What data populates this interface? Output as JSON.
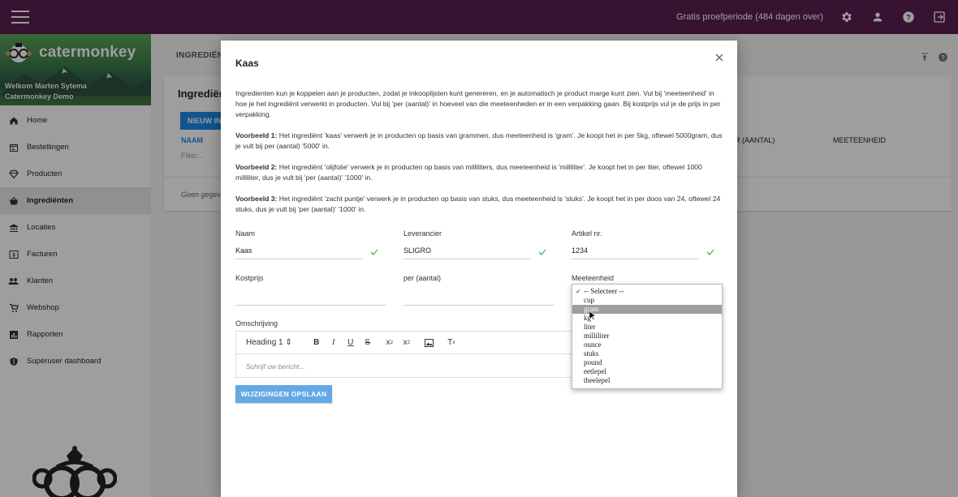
{
  "topbar": {
    "trial_text": "Gratis proefperiode (484 dagen over)",
    "icons": [
      "menu-icon",
      "gear-icon",
      "account-icon",
      "help-icon",
      "logout-icon"
    ],
    "color": "#5a1f50"
  },
  "sidebar": {
    "logo_text": "catermonkey",
    "welcome_line1": "Welkom Marten Sytema",
    "welcome_line2": "Catermonkey Demo",
    "items": [
      {
        "label": "Home",
        "icon": "home-icon"
      },
      {
        "label": "Bestellingen",
        "icon": "calendar-icon"
      },
      {
        "label": "Producten",
        "icon": "diamond-icon"
      },
      {
        "label": "Ingrediënten",
        "icon": "basket-icon",
        "active": true
      },
      {
        "label": "Locaties",
        "icon": "bank-icon"
      },
      {
        "label": "Facturen",
        "icon": "dollar-icon"
      },
      {
        "label": "Klanten",
        "icon": "people-icon"
      },
      {
        "label": "Webshop",
        "icon": "cart-icon"
      },
      {
        "label": "Rapporten",
        "icon": "chart-icon"
      },
      {
        "label": "Superuser dashboard",
        "icon": "shield-icon"
      }
    ]
  },
  "main": {
    "breadcrumb": "INGREDIËNT",
    "card_title": "Ingrediënt",
    "new_button": "NIEUW IN",
    "col_naam": "NAAM",
    "filter_placeholder": "Filter...",
    "col_per": "R (AANTAL)",
    "col_meeteenheid": "MEETEENHEID",
    "empty_text": "Geen gegev"
  },
  "dialog": {
    "title": "Kaas",
    "intro": "Ingredienten kun je koppelen aan je producten, zodat je inkooplijsten kunt genereren, en je automatisch je product marge kunt zien. Vul bij 'meeteenheid' in hoe je het ingrediënt verwerkt in producten. Vul bij 'per (aantal)' in hoeveel van die meeteenheden er in een verpakking gaan. Bij kostprijs vul je de prijs in per verpakking.",
    "ex1_label": "Voorbeeld 1:",
    "ex1_text": " Het ingrediënt 'kaas' verwerk je in producten op basis van grammen, dus meeteenheid is 'gram'. Je koopt het in per 5kg, oftewel 5000gram, dus je vult bij per (aantal) '5000' in.",
    "ex2_label": "Voorbeeld 2:",
    "ex2_text": " Het ingrediënt 'olijfolie' verwerk je in producten op basis van milliliters, dus meeteenheid is 'milliliter'. Je koopt het in per liter, oftewel 1000 milliliter, dus je vult bij 'per (aantal)' '1000' in.",
    "ex3_label": "Voorbeeld 3:",
    "ex3_text": " Het ingrediënt 'zacht puntje' verwerk je in producten op basis van stuks, dus meeteenheid is 'stuks'. Je koopt het in per doos van 24, oftewel 24 stuks, dus je vult bij 'per (aantal)' '1000' in.",
    "fields": {
      "naam_label": "Naam",
      "naam_value": "Kaas",
      "leverancier_label": "Leverancier",
      "leverancier_value": "SLIGRO",
      "artikel_label": "Artikel nr.",
      "artikel_value": "1234",
      "kostprijs_label": "Kostprijs",
      "kostprijs_value": "",
      "per_label": "per (aantal)",
      "per_value": "",
      "meeteenheid_label": "Meeteenheid",
      "omschrijving_label": "Omschrijving"
    },
    "editor": {
      "heading_select": "Heading 1",
      "placeholder": "Schrijf uw bericht..."
    },
    "save_button": "WIJZIGINGEN OPSLAAN",
    "dropdown": {
      "options": [
        "-- Selecteer --",
        "cup",
        "gram",
        "kg",
        "liter",
        "milliliter",
        "ounce",
        "stuks",
        "pound",
        "eetlepel",
        "theelepel"
      ],
      "selected": "-- Selecteer --",
      "highlighted": "gram"
    }
  }
}
